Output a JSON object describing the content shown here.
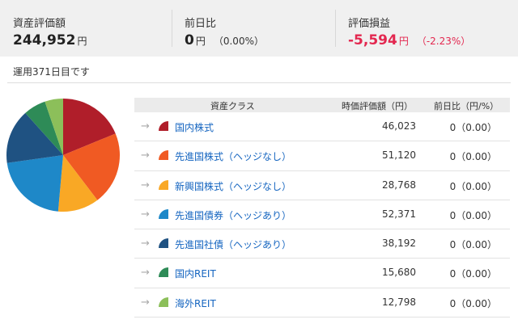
{
  "summary": {
    "total": {
      "label": "資産評価額",
      "value": "244,952",
      "unit": "円"
    },
    "daychange": {
      "label": "前日比",
      "value": "0",
      "unit": "円",
      "pct": "（0.00%）"
    },
    "pl": {
      "label": "評価損益",
      "value": "-5,594",
      "unit": "円",
      "pct": "（-2.23%）",
      "color": "#e3274f"
    }
  },
  "days_text": "運用371日目です",
  "table": {
    "headers": {
      "asset": "資産クラス",
      "value": "時価評価額（円）",
      "change": "前日比（円/%）"
    },
    "rows": [
      {
        "name": "国内株式",
        "amount": "46,023",
        "change": "0（0.00）",
        "color": "#b01e2a",
        "icon": "arrow-right-icon"
      },
      {
        "name": "先進国株式（ヘッジなし）",
        "amount": "51,120",
        "change": "0（0.00）",
        "color": "#f05a23",
        "icon": "arrow-right-icon"
      },
      {
        "name": "新興国株式（ヘッジなし）",
        "amount": "28,768",
        "change": "0（0.00）",
        "color": "#f9a825",
        "icon": "arrow-right-icon"
      },
      {
        "name": "先進国債券（ヘッジあり）",
        "amount": "52,371",
        "change": "0（0.00）",
        "color": "#1e88c8",
        "icon": "arrow-right-icon"
      },
      {
        "name": "先進国社債（ヘッジあり）",
        "amount": "38,192",
        "change": "0（0.00）",
        "color": "#1f5282",
        "icon": "arrow-right-icon"
      },
      {
        "name": "国内REIT",
        "amount": "15,680",
        "change": "0（0.00）",
        "color": "#2e8b57",
        "icon": "arrow-right-icon"
      },
      {
        "name": "海外REIT",
        "amount": "12,798",
        "change": "0（0.00）",
        "color": "#8cbf5a",
        "icon": "arrow-right-icon"
      }
    ]
  },
  "pie": {
    "slices": [
      {
        "name": "国内株式",
        "value": 46023,
        "color": "#b01e2a"
      },
      {
        "name": "先進国株式（ヘッジなし）",
        "value": 51120,
        "color": "#f05a23"
      },
      {
        "name": "新興国株式（ヘッジなし）",
        "value": 28768,
        "color": "#f9a825"
      },
      {
        "name": "先進国債券（ヘッジあり）",
        "value": 52371,
        "color": "#1e88c8"
      },
      {
        "name": "先進国社債（ヘッジあり）",
        "value": 38192,
        "color": "#1f5282"
      },
      {
        "name": "国内REIT",
        "value": 15680,
        "color": "#2e8b57"
      },
      {
        "name": "海外REIT",
        "value": 12798,
        "color": "#8cbf5a"
      }
    ]
  }
}
